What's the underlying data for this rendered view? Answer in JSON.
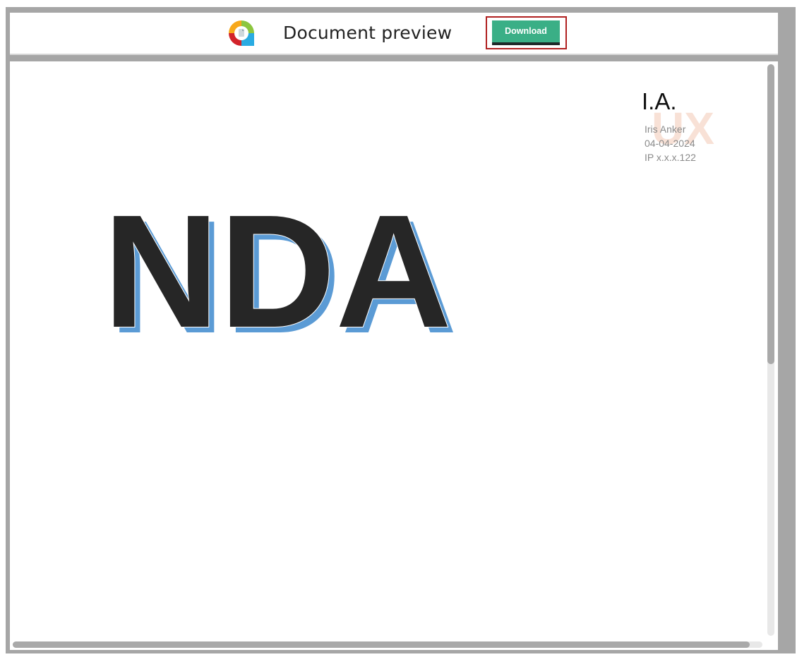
{
  "header": {
    "title": "Document preview",
    "download_label": "Download"
  },
  "document": {
    "heading": "NDA",
    "signature": {
      "initials": "I.A.",
      "name": "Iris Anker",
      "date": "04-04-2024",
      "ip": "IP x.x.x.122"
    }
  },
  "colors": {
    "download_button": "#3aaf86",
    "download_outline": "#b02020",
    "heading_fill": "#262626",
    "heading_shadow": "#5b9bd5",
    "frame": "#a6a6a6"
  },
  "icons": {
    "logo": "app-logo-icon"
  },
  "scroll": {
    "vertical_position": 0.0,
    "horizontal_position": 0.0
  }
}
